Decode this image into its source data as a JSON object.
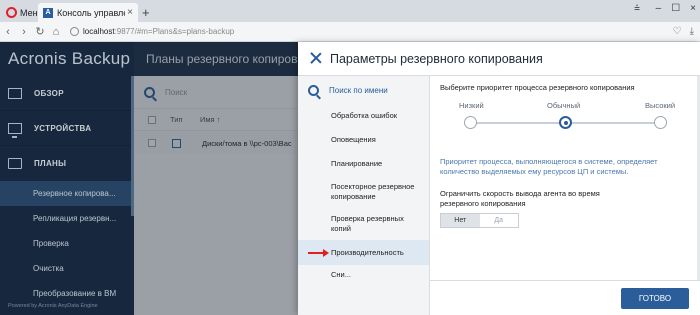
{
  "browser": {
    "menu_label": "Меню",
    "tab_title": "Консоль управления резерв",
    "tab_close": "×",
    "new_tab": "+",
    "window_controls": [
      "–",
      "☐",
      "×"
    ],
    "extra_icon": "⩮",
    "url_host": "localhost",
    "url_rest": ":9877/#m=Plans&s=plans-backup",
    "nav_icons": [
      "back-arrow-icon",
      "forward-arrow-icon",
      "reload-icon",
      "home-icon"
    ],
    "addr_icons": [
      "bookmark-heart-icon",
      "download-icon"
    ]
  },
  "app": {
    "brand": "Acronis Backup",
    "powered_by": "Powered by Acronis AnyData Engine",
    "nav": [
      {
        "label": "ОБЗОР"
      },
      {
        "label": "УСТРОЙСТВА"
      },
      {
        "label": "ПЛАНЫ"
      }
    ],
    "subnav": [
      {
        "label": "Резервное копирова..."
      },
      {
        "label": "Репликация резервн..."
      },
      {
        "label": "Проверка"
      },
      {
        "label": "Очистка"
      },
      {
        "label": "Преобразование в ВМ"
      }
    ]
  },
  "main": {
    "title": "Планы резервного копиров",
    "search_placeholder": "Поиск",
    "col_type": "Тип",
    "col_name": "Имя ↑",
    "row_name": "Диски/тома в \\\\pc-003\\Bac"
  },
  "panel": {
    "title": "Параметры резервного копирования",
    "nav_search": "Поиск по имени",
    "nav_items": [
      "Обработка ошибок",
      "Оповещения",
      "Планирование",
      "Посекторное резервное копирование",
      "Проверка резервных копий",
      "Производительность",
      "Сни..."
    ],
    "priority_label": "Выберите приоритет процесса резервного копирования",
    "priority_levels": [
      "Низкий",
      "Обычный",
      "Высокий"
    ],
    "priority_selected": 1,
    "priority_desc": "Приоритет процесса, выполняющегося в системе, определяет количество выделяемых ему ресурсов ЦП и системы.",
    "limit_label": "Ограничить скорость вывода агента во время резервного копирования",
    "toggle_off": "Нет",
    "toggle_on": "Да",
    "done": "ГОТОВО"
  },
  "colors": {
    "sidebar_bg": "#1a2d45",
    "accent": "#2a5d9a",
    "arrow": "#e0201a"
  }
}
